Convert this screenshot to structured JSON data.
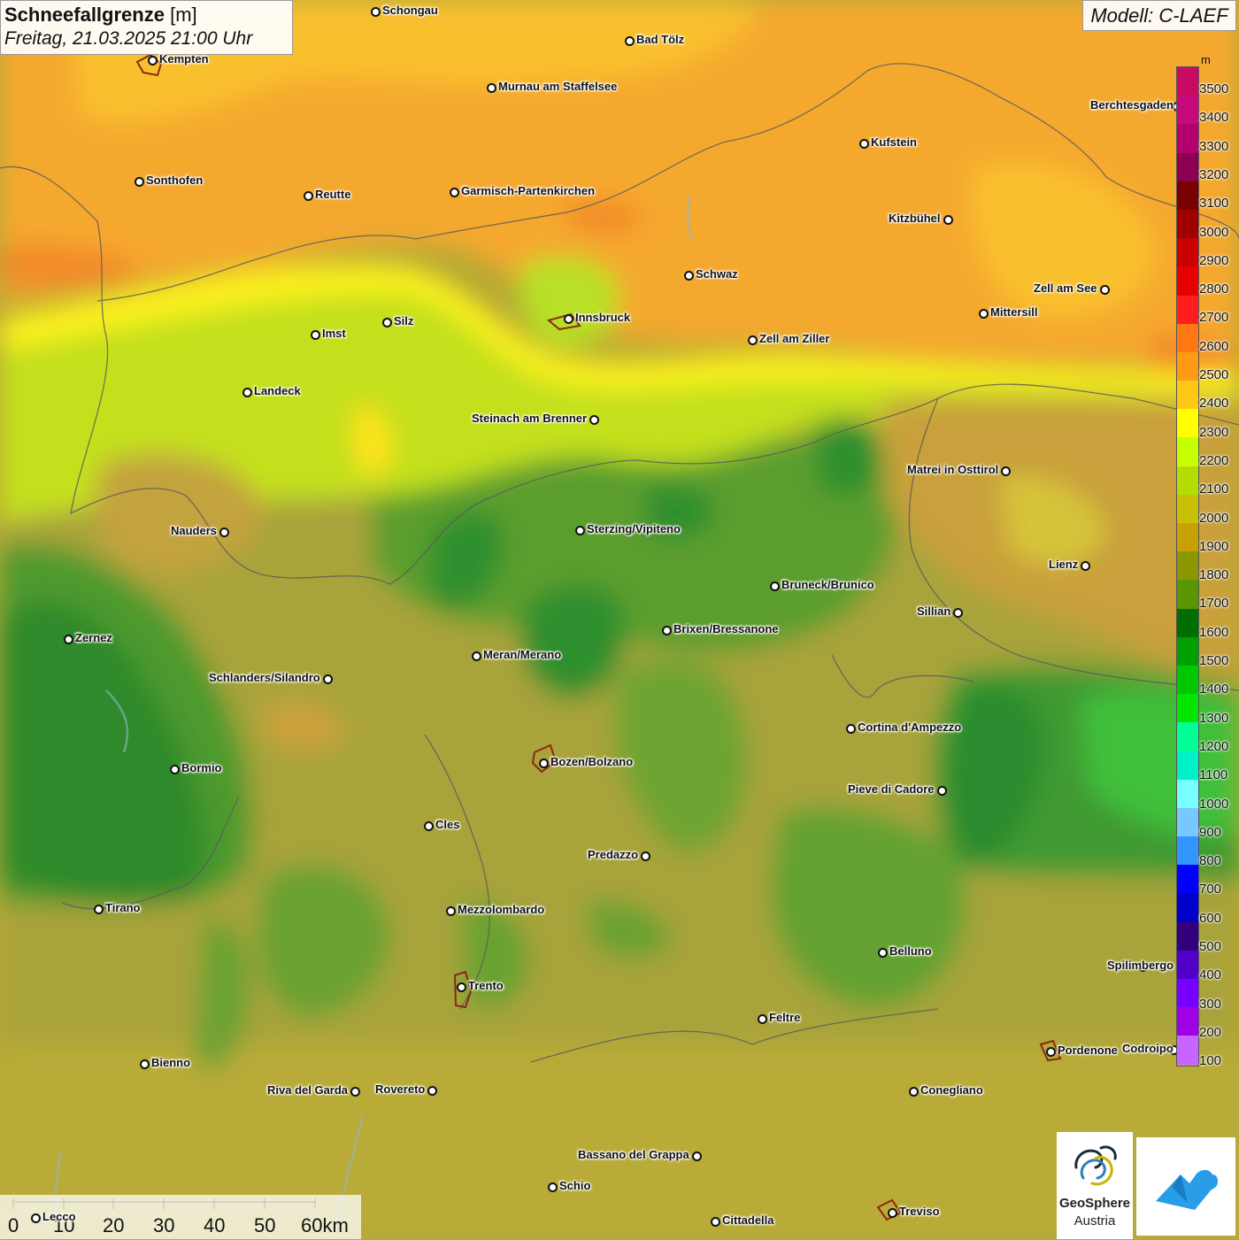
{
  "title": {
    "parameter": "Schneefallgrenze",
    "unit": "[m]",
    "datetime": "Freitag, 21.03.2025 21:00 Uhr"
  },
  "model_label": "Modell: C-LAEF",
  "legend": {
    "unit": "m",
    "values": [
      "3500",
      "3400",
      "3300",
      "3200",
      "3100",
      "3000",
      "2900",
      "2800",
      "2700",
      "2600",
      "2500",
      "2400",
      "2300",
      "2200",
      "2100",
      "2000",
      "1900",
      "1800",
      "1700",
      "1600",
      "1500",
      "1400",
      "1300",
      "1200",
      "1100",
      "1000",
      "900",
      "800",
      "700",
      "600",
      "500",
      "400",
      "300",
      "200",
      "100"
    ],
    "colors": [
      "#c80a64",
      "#c8097a",
      "#b4006e",
      "#8c0050",
      "#780000",
      "#a00000",
      "#c80000",
      "#e60000",
      "#ff1e1e",
      "#ff7814",
      "#ff9a14",
      "#ffc814",
      "#ffff00",
      "#c8ff00",
      "#b4dc00",
      "#c8c000",
      "#c8a000",
      "#8c9600",
      "#5a9600",
      "#006e00",
      "#00a000",
      "#00c800",
      "#00e600",
      "#00ff96",
      "#00f0c8",
      "#78ffff",
      "#78c8ff",
      "#3296ff",
      "#0000ff",
      "#0000c8",
      "#32007a",
      "#5000c8",
      "#7800ff",
      "#a000e6",
      "#c864ff"
    ]
  },
  "cities": [
    {
      "name": "Schongau",
      "label_side": "right"
    },
    {
      "name": "Bad Tölz",
      "label_side": "right"
    },
    {
      "name": "Kempten",
      "label_side": "right"
    },
    {
      "name": "Murnau am Staffelsee",
      "label_side": "right"
    },
    {
      "name": "Berchtesgaden",
      "label_side": "right"
    },
    {
      "name": "Kufstein",
      "label_side": "right"
    },
    {
      "name": "Sonthofen",
      "label_side": "right"
    },
    {
      "name": "Reutte",
      "label_side": "right"
    },
    {
      "name": "Garmisch-Partenkirchen",
      "label_side": "right"
    },
    {
      "name": "Kitzbühel",
      "label_side": "left"
    },
    {
      "name": "Schwaz",
      "label_side": "right"
    },
    {
      "name": "Zell am See",
      "label_side": "left"
    },
    {
      "name": "Innsbruck",
      "label_side": "right"
    },
    {
      "name": "Mittersill",
      "label_side": "right"
    },
    {
      "name": "Imst",
      "label_side": "right"
    },
    {
      "name": "Silz",
      "label_side": "right"
    },
    {
      "name": "Zell am Ziller",
      "label_side": "right"
    },
    {
      "name": "Landeck",
      "label_side": "right"
    },
    {
      "name": "Steinach am Brenner",
      "label_side": "left"
    },
    {
      "name": "Matrei in Osttirol",
      "label_side": "left"
    },
    {
      "name": "Nauders",
      "label_side": "left"
    },
    {
      "name": "Sterzing/Vipiteno",
      "label_side": "right"
    },
    {
      "name": "Lienz",
      "label_side": "left"
    },
    {
      "name": "Bruneck/Brunico",
      "label_side": "right"
    },
    {
      "name": "Sillian",
      "label_side": "left"
    },
    {
      "name": "Brixen/Bressanone",
      "label_side": "right"
    },
    {
      "name": "Zernez",
      "label_side": "right"
    },
    {
      "name": "Meran/Merano",
      "label_side": "right"
    },
    {
      "name": "Schlanders/Silandro",
      "label_side": "left"
    },
    {
      "name": "Cortina d'Ampezzo",
      "label_side": "right"
    },
    {
      "name": "Bormio",
      "label_side": "right"
    },
    {
      "name": "Bozen/Bolzano",
      "label_side": "right"
    },
    {
      "name": "Pieve di Cadore",
      "label_side": "left"
    },
    {
      "name": "Cles",
      "label_side": "right"
    },
    {
      "name": "Predazzo",
      "label_side": "left"
    },
    {
      "name": "Tirano",
      "label_side": "right"
    },
    {
      "name": "Mezzolombardo",
      "label_side": "right"
    },
    {
      "name": "Belluno",
      "label_side": "right"
    },
    {
      "name": "Spilimbergo",
      "label_side": "right"
    },
    {
      "name": "Trento",
      "label_side": "right"
    },
    {
      "name": "Feltre",
      "label_side": "right"
    },
    {
      "name": "Pordenone",
      "label_side": "right"
    },
    {
      "name": "Codroipo",
      "label_side": "right"
    },
    {
      "name": "Bienno",
      "label_side": "right"
    },
    {
      "name": "Riva del Garda",
      "label_side": "left"
    },
    {
      "name": "Rovereto",
      "label_side": "left"
    },
    {
      "name": "Conegliano",
      "label_side": "right"
    },
    {
      "name": "Bassano del Grappa",
      "label_side": "left"
    },
    {
      "name": "Schio",
      "label_side": "right"
    },
    {
      "name": "Treviso",
      "label_side": "right"
    },
    {
      "name": "Cittadella",
      "label_side": "right"
    },
    {
      "name": "Lecco",
      "label_side": "right"
    }
  ],
  "scale_bar": {
    "labels": [
      "0",
      "10",
      "20",
      "30",
      "40",
      "50",
      "60km"
    ]
  },
  "logos": {
    "geosphere_line1": "GeoSphere",
    "geosphere_line2": "Austria"
  }
}
